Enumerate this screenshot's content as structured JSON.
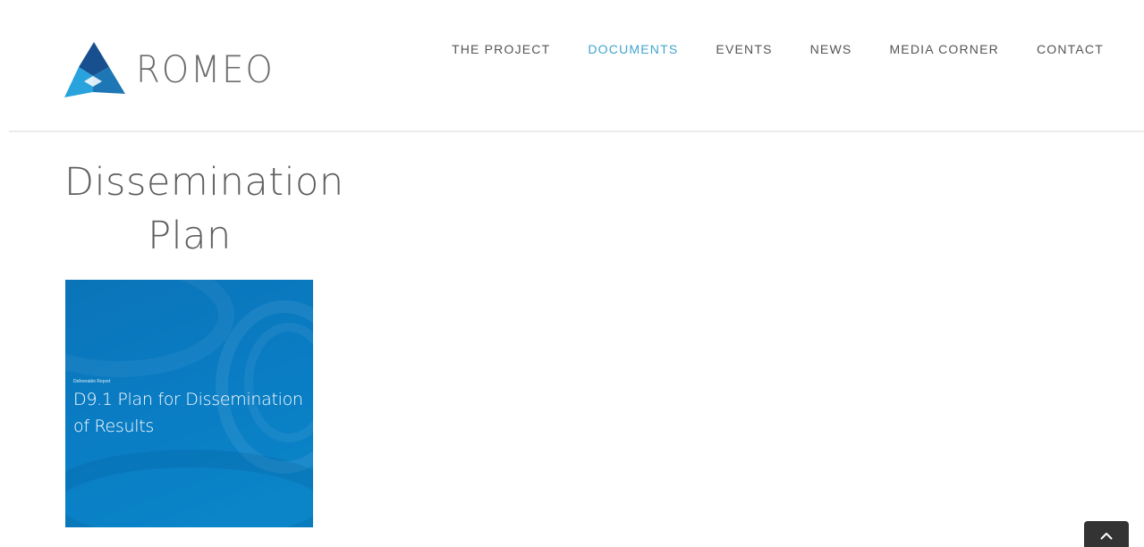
{
  "brand": {
    "name": "ROMEO",
    "colors": {
      "dark_blue": "#174f8f",
      "mid_blue": "#1e77b5",
      "light_blue": "#29a3dd"
    }
  },
  "nav": {
    "items": [
      {
        "label": "THE PROJECT",
        "active": false
      },
      {
        "label": "DOCUMENTS",
        "active": true
      },
      {
        "label": "EVENTS",
        "active": false
      },
      {
        "label": "NEWS",
        "active": false
      },
      {
        "label": "MEDIA CORNER",
        "active": false
      },
      {
        "label": "CONTACT",
        "active": false
      }
    ],
    "active_color": "#42a5cf",
    "color": "#555555"
  },
  "page": {
    "title": "Dissemination Plan"
  },
  "document": {
    "kicker": "Deliverable Report",
    "title": "D9.1 Plan for Dissemination of Results",
    "cover_color": "#0a7cc3"
  },
  "back_to_top": {
    "icon": "chevron-up-icon"
  }
}
